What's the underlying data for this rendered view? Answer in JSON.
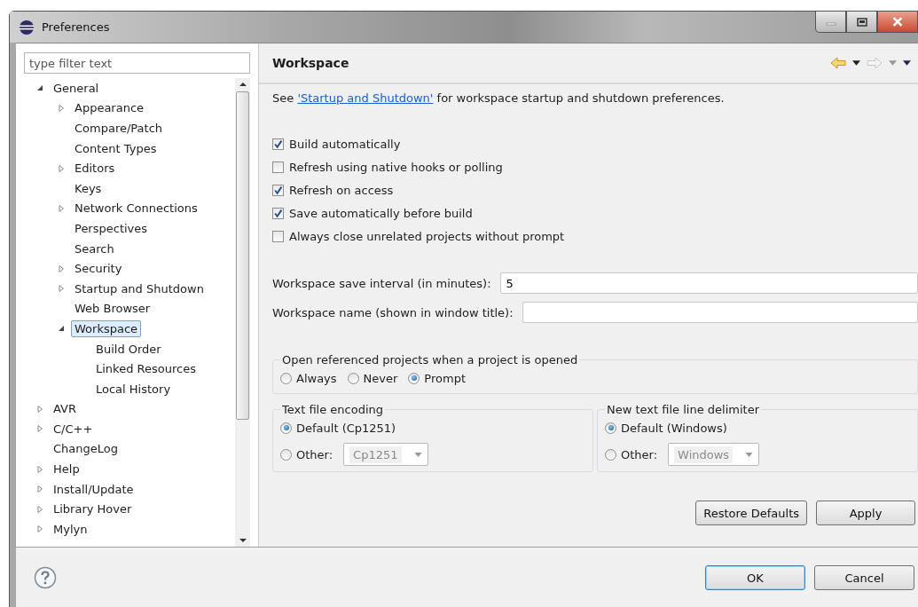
{
  "window": {
    "title": "Preferences"
  },
  "filter": {
    "placeholder": "type filter text"
  },
  "tree": [
    {
      "label": "General",
      "kind": "folder",
      "expanded": true,
      "selected": false,
      "children": [
        {
          "label": "Appearance",
          "kind": "folder",
          "expanded": false,
          "selected": false
        },
        {
          "label": "Compare/Patch",
          "kind": "leaf",
          "selected": false
        },
        {
          "label": "Content Types",
          "kind": "leaf",
          "selected": false
        },
        {
          "label": "Editors",
          "kind": "folder",
          "expanded": false,
          "selected": false
        },
        {
          "label": "Keys",
          "kind": "leaf",
          "selected": false
        },
        {
          "label": "Network Connections",
          "kind": "folder",
          "expanded": false,
          "selected": false
        },
        {
          "label": "Perspectives",
          "kind": "leaf",
          "selected": false
        },
        {
          "label": "Search",
          "kind": "leaf",
          "selected": false
        },
        {
          "label": "Security",
          "kind": "folder",
          "expanded": false,
          "selected": false
        },
        {
          "label": "Startup and Shutdown",
          "kind": "folder",
          "expanded": false,
          "selected": false
        },
        {
          "label": "Web Browser",
          "kind": "leaf",
          "selected": false
        },
        {
          "label": "Workspace",
          "kind": "folder",
          "expanded": true,
          "selected": true,
          "children": [
            {
              "label": "Build Order",
              "kind": "leaf",
              "selected": false
            },
            {
              "label": "Linked Resources",
              "kind": "leaf",
              "selected": false
            },
            {
              "label": "Local History",
              "kind": "leaf",
              "selected": false
            }
          ]
        }
      ]
    },
    {
      "label": "AVR",
      "kind": "folder",
      "expanded": false,
      "selected": false
    },
    {
      "label": "C/C++",
      "kind": "folder",
      "expanded": false,
      "selected": false
    },
    {
      "label": "ChangeLog",
      "kind": "leaf",
      "selected": false
    },
    {
      "label": "Help",
      "kind": "folder",
      "expanded": false,
      "selected": false
    },
    {
      "label": "Install/Update",
      "kind": "folder",
      "expanded": false,
      "selected": false
    },
    {
      "label": "Library Hover",
      "kind": "folder",
      "expanded": false,
      "selected": false
    },
    {
      "label": "Mylyn",
      "kind": "folder",
      "expanded": false,
      "selected": false
    }
  ],
  "page": {
    "title": "Workspace",
    "intro": {
      "before": "See ",
      "link": "'Startup and Shutdown'",
      "after": " for workspace startup and shutdown preferences."
    },
    "checkboxes": [
      {
        "label": "Build automatically",
        "checked": true
      },
      {
        "label": "Refresh using native hooks or polling",
        "checked": false
      },
      {
        "label": "Refresh on access",
        "checked": true
      },
      {
        "label": "Save automatically before build",
        "checked": true
      },
      {
        "label": "Always close unrelated projects without prompt",
        "checked": false
      }
    ],
    "fields": [
      {
        "label": "Workspace save interval (in minutes):",
        "value": "5"
      },
      {
        "label": "Workspace name (shown in window title):"
      }
    ],
    "open_group": {
      "title": "Open referenced projects when a project is opened",
      "options": [
        {
          "label": "Always",
          "selected": false
        },
        {
          "label": "Never",
          "selected": false
        },
        {
          "label": "Prompt",
          "selected": true
        }
      ]
    },
    "encoding_group": {
      "title": "Text file encoding",
      "default_option": {
        "label": "Default (Cp1251)",
        "selected": true
      },
      "other_option": {
        "label": "Other:",
        "selected": false
      },
      "combo": "Cp1251"
    },
    "delimiter_group": {
      "title": "New text file line delimiter",
      "default_option": {
        "label": "Default (Windows)",
        "selected": true
      },
      "other_option": {
        "label": "Other:",
        "selected": false
      },
      "combo": "Windows"
    },
    "buttons": [
      "Restore Defaults",
      "Apply"
    ]
  },
  "dialog_buttons": [
    {
      "label": "OK",
      "default": true
    },
    {
      "label": "Cancel",
      "default": false
    }
  ]
}
